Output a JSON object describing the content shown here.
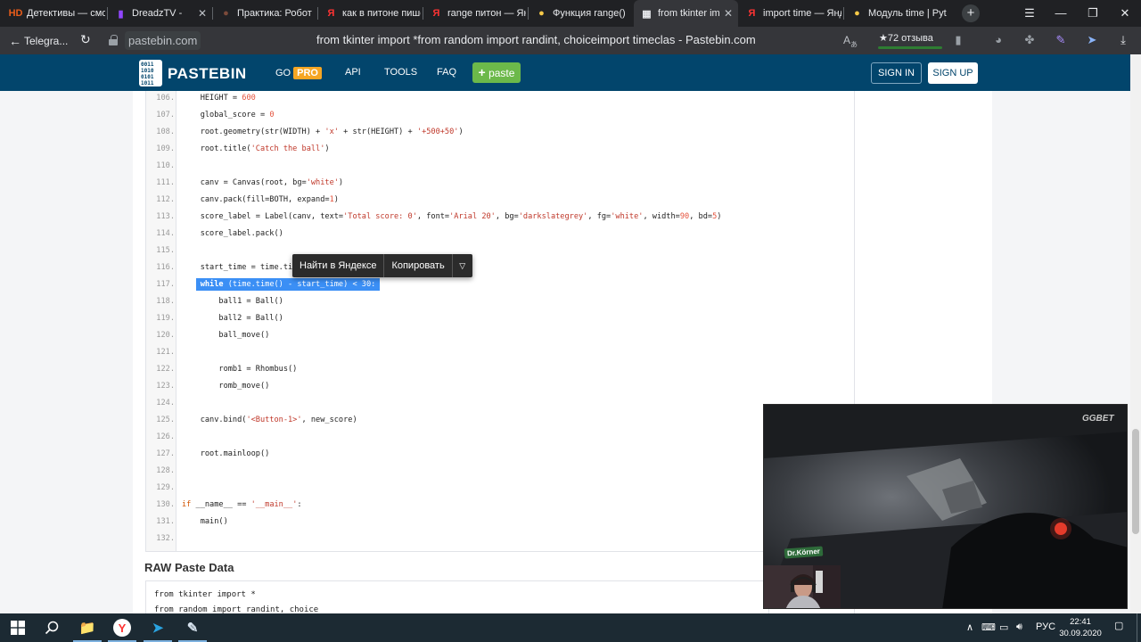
{
  "browser": {
    "tabs": [
      {
        "title": "Детективы — смотреть",
        "icon": "hd-icon",
        "fav": "HD",
        "fav_color": "#e85d1b"
      },
      {
        "title": "DreadzTV -",
        "icon": "twitch-icon",
        "fav": "▮",
        "fav_color": "#9146ff"
      },
      {
        "title": "Практика: Робот",
        "icon": "site-icon",
        "fav": "●",
        "fav_color": "#7b4a3a"
      },
      {
        "title": "как в питоне пишется",
        "icon": "yandex-icon",
        "fav": "Я",
        "fav_color": "#ff3333"
      },
      {
        "title": "range питон — Яндекс",
        "icon": "yandex-icon",
        "fav": "Я",
        "fav_color": "#ff3333"
      },
      {
        "title": "Функция range()",
        "icon": "python-icon",
        "fav": "●",
        "fav_color": "#f7c948"
      },
      {
        "title": "from tkinter import",
        "icon": "pastebin-icon",
        "fav": "▦",
        "fav_color": "#e8eaed"
      },
      {
        "title": "import time — Яндекс",
        "icon": "yandex-icon",
        "fav": "Я",
        "fav_color": "#ff3333"
      },
      {
        "title": "Модуль time | Python",
        "icon": "python-icon",
        "fav": "●",
        "fav_color": "#f7c948"
      }
    ],
    "new_tab": "+",
    "window_controls": {
      "menu": "☰",
      "minimize": "—",
      "restore": "❐",
      "close": "✕"
    },
    "back_label": "Telegra...",
    "domain": "pastebin.com",
    "page_title": "from tkinter import *from random import randint, choiceimport timeclas - Pastebin.com",
    "reviews": "★72 отзыва"
  },
  "site": {
    "logo_text": "PASTEBIN",
    "logo_bits": "0011 1010 0101 1011",
    "nav": {
      "go": "GO",
      "pro": "PRO",
      "api": "API",
      "tools": "TOOLS",
      "faq": "FAQ",
      "paste": "paste"
    },
    "sign_in": "SIGN IN",
    "sign_up": "SIGN UP"
  },
  "context_menu": {
    "search": "Найти в Яндексе",
    "copy": "Копировать"
  },
  "code_lines": [
    {
      "n": "106.",
      "t": "    HEIGHT = 600"
    },
    {
      "n": "107.",
      "t": "    global_score = 0"
    },
    {
      "n": "108.",
      "t": "    root.geometry(str(WIDTH) + 'x' + str(HEIGHT) + '+500+50')"
    },
    {
      "n": "109.",
      "t": "    root.title('Catch the ball')"
    },
    {
      "n": "110.",
      "t": ""
    },
    {
      "n": "111.",
      "t": "    canv = Canvas(root, bg='white')"
    },
    {
      "n": "112.",
      "t": "    canv.pack(fill=BOTH, expand=1)"
    },
    {
      "n": "113.",
      "t": "    score_label = Label(canv, text='Total score: 0', font='Arial 20', bg='darkslategrey', fg='white', width=90, bd=5)"
    },
    {
      "n": "114.",
      "t": "    score_label.pack()"
    },
    {
      "n": "115.",
      "t": ""
    },
    {
      "n": "116.",
      "t": "    start_time = time.time()"
    },
    {
      "n": "117.",
      "t": "    while (time.time() - start_time) < 30:"
    },
    {
      "n": "118.",
      "t": "        ball1 = Ball()"
    },
    {
      "n": "119.",
      "t": "        ball2 = Ball()"
    },
    {
      "n": "120.",
      "t": "        ball_move()"
    },
    {
      "n": "121.",
      "t": ""
    },
    {
      "n": "122.",
      "t": "        romb1 = Rhombus()"
    },
    {
      "n": "123.",
      "t": "        romb_move()"
    },
    {
      "n": "124.",
      "t": ""
    },
    {
      "n": "125.",
      "t": "    canv.bind('<Button-1>', new_score)"
    },
    {
      "n": "126.",
      "t": ""
    },
    {
      "n": "127.",
      "t": "    root.mainloop()"
    },
    {
      "n": "128.",
      "t": ""
    },
    {
      "n": "129.",
      "t": ""
    },
    {
      "n": "130.",
      "t": "if __name__ == '__main__':"
    },
    {
      "n": "131.",
      "t": "    main()"
    },
    {
      "n": "132.",
      "t": ""
    }
  ],
  "raw": {
    "title": "RAW Paste Data",
    "lines": [
      "from tkinter import *",
      "from random import randint, choice"
    ]
  },
  "video": {
    "overlay_brand": "GGBET",
    "sponsor_badge": "Dr.Körner"
  },
  "taskbar": {
    "apps": [
      {
        "name": "taskbar-explorer",
        "icon": "folder-icon",
        "glyph": "📁"
      },
      {
        "name": "taskbar-yandex-browser",
        "icon": "yandex-browser-icon",
        "glyph": "Y"
      },
      {
        "name": "taskbar-telegram",
        "icon": "telegram-icon",
        "glyph": "➤"
      },
      {
        "name": "taskbar-notepad",
        "icon": "notepad-icon",
        "glyph": "✎"
      }
    ],
    "tray": {
      "chevron": "∧",
      "lang": "РУС"
    },
    "time": "22:41",
    "date": "30.09.2020"
  },
  "colors": {
    "pastebin_nav": "#02456c",
    "pro_badge": "#f6a623",
    "paste_button": "#6cb94a",
    "selection": "#3b8ff5"
  }
}
